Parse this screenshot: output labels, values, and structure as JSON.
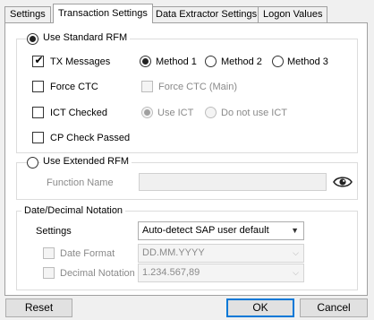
{
  "tabs": [
    {
      "label": "Settings",
      "active": false
    },
    {
      "label": "Transaction Settings",
      "active": true
    },
    {
      "label": "Data Extractor Settings",
      "active": false
    },
    {
      "label": "Logon Values",
      "active": false
    }
  ],
  "rfm": {
    "standard_label": "Use Standard RFM",
    "standard_selected": true,
    "tx_messages": {
      "label": "TX Messages",
      "checked": true
    },
    "methods": [
      {
        "label": "Method 1",
        "selected": true
      },
      {
        "label": "Method 2",
        "selected": false
      },
      {
        "label": "Method 3",
        "selected": false
      }
    ],
    "force_ctc": {
      "label": "Force CTC",
      "checked": false
    },
    "force_ctc_main": {
      "label": "Force CTC (Main)",
      "checked": false,
      "enabled": false
    },
    "ict_checked": {
      "label": "ICT Checked",
      "checked": false
    },
    "use_ict": {
      "label": "Use ICT",
      "selected": true,
      "enabled": false
    },
    "do_not_use_ict": {
      "label": "Do not use ICT",
      "selected": false,
      "enabled": false
    },
    "cp_check_passed": {
      "label": "CP Check Passed",
      "checked": false
    },
    "extended_label": "Use Extended RFM",
    "extended_selected": false,
    "function_name_label": "Function Name",
    "function_name_value": "",
    "eye_icon": "eye-icon"
  },
  "date_decimal": {
    "group_title": "Date/Decimal Notation",
    "settings_label": "Settings",
    "settings_value": "Auto-detect SAP user default",
    "date_format": {
      "label": "Date Format",
      "checked": false,
      "value": "DD.MM.YYYY"
    },
    "decimal_notation": {
      "label": "Decimal Notation",
      "checked": false,
      "value": "1.234.567,89"
    }
  },
  "buttons": {
    "reset": "Reset",
    "ok": "OK",
    "cancel": "Cancel"
  },
  "colors": {
    "focus": "#0078d7",
    "disabled_text": "#8a8a8a"
  }
}
